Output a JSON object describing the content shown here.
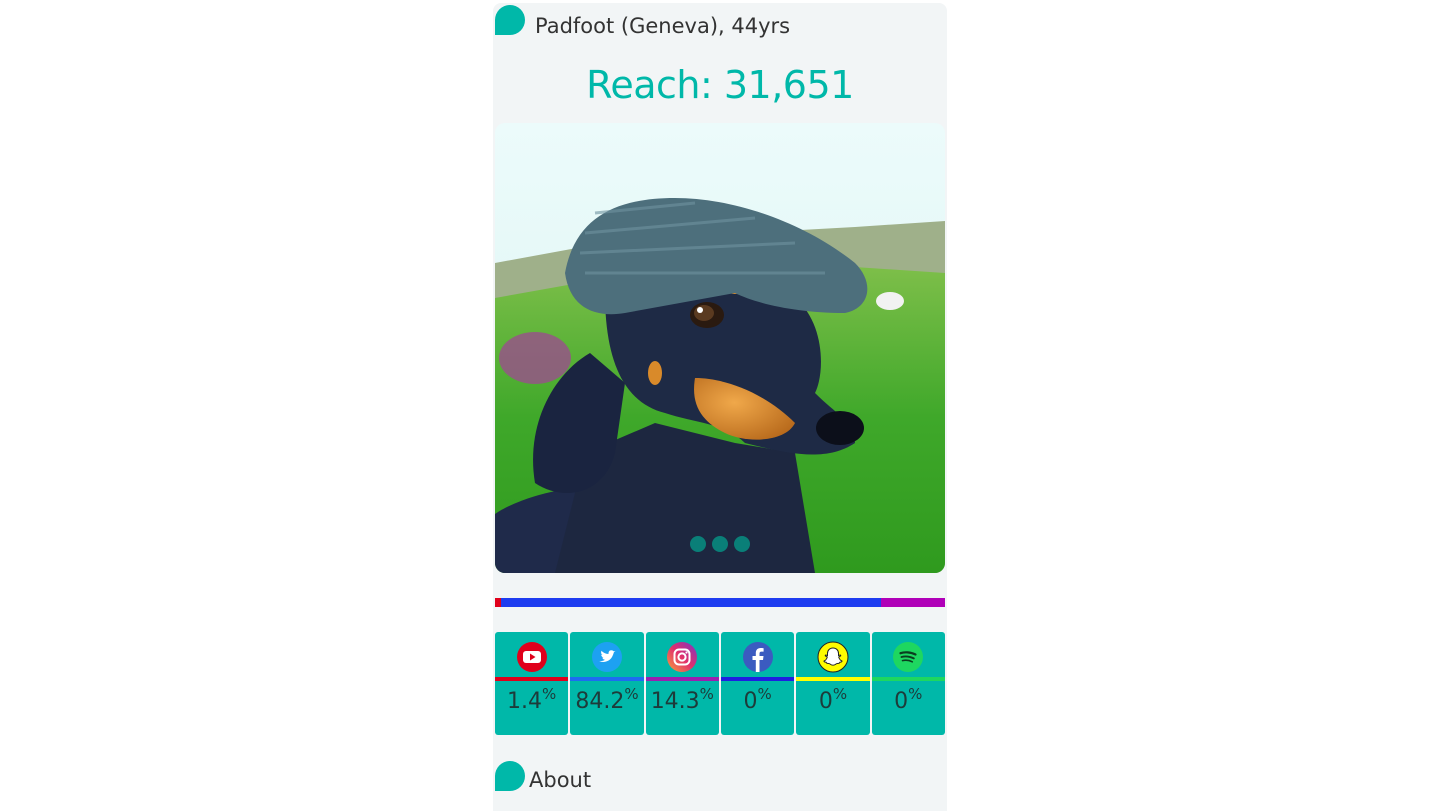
{
  "profile": {
    "name_line": "Padfoot (Geneva), 44yrs",
    "reach_text": "Reach: 31,651"
  },
  "carousel": {
    "dot_count": 3,
    "dot_color": "#0a7f78"
  },
  "share_bar": [
    {
      "network": "youtube",
      "share": 1.4,
      "color": "#e0001b"
    },
    {
      "network": "twitter",
      "share": 84.2,
      "color": "#1e3cf0"
    },
    {
      "network": "instagram",
      "share": 14.3,
      "color": "#b000b8"
    }
  ],
  "stats": [
    {
      "network": "youtube",
      "icon": "youtube-icon",
      "value": "1.4",
      "unit": "%",
      "accent": "#e0001b"
    },
    {
      "network": "twitter",
      "icon": "twitter-icon",
      "value": "84.2",
      "unit": "%",
      "accent": "#1e6cf0"
    },
    {
      "network": "instagram",
      "icon": "instagram-icon",
      "value": "14.3",
      "unit": "%",
      "accent": "#9b1fb0"
    },
    {
      "network": "facebook",
      "icon": "facebook-icon",
      "value": "0",
      "unit": "%",
      "accent": "#1f1fe0"
    },
    {
      "network": "snapchat",
      "icon": "snapchat-icon",
      "value": "0",
      "unit": "%",
      "accent": "#ffff00"
    },
    {
      "network": "spotify",
      "icon": "spotify-icon",
      "value": "0",
      "unit": "%",
      "accent": "#1ed760"
    }
  ],
  "about": {
    "label": "About"
  },
  "colors": {
    "accent": "#00b8a9",
    "card_background": "#f2f5f6"
  }
}
